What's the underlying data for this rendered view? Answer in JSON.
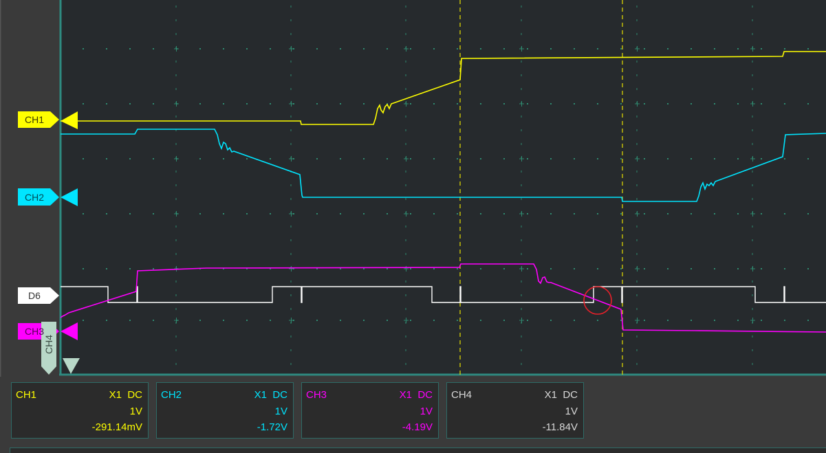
{
  "markers": {
    "ch1": {
      "label": "CH1",
      "color": "#ffff00"
    },
    "ch2": {
      "label": "CH2",
      "color": "#00e5ff"
    },
    "d6": {
      "label": "D6",
      "color": "#ffffff"
    },
    "ch3": {
      "label": "CH3",
      "color": "#ff00ff"
    },
    "ch4": {
      "label": "CH4",
      "color": "#b8d8c8"
    }
  },
  "channels": [
    {
      "name": "CH1",
      "probe": "X1",
      "coupling": "DC",
      "scale": "1V",
      "offset": "-291.14mV",
      "color": "#ffff00"
    },
    {
      "name": "CH2",
      "probe": "X1",
      "coupling": "DC",
      "scale": "1V",
      "offset": "-1.72V",
      "color": "#00e5ff"
    },
    {
      "name": "CH3",
      "probe": "X1",
      "coupling": "DC",
      "scale": "1V",
      "offset": "-4.19V",
      "color": "#ff00ff"
    },
    {
      "name": "CH4",
      "probe": "X1",
      "coupling": "DC",
      "scale": "1V",
      "offset": "-11.84V",
      "color": "#d8d8d8"
    }
  ],
  "colors": {
    "grid_bg": "#262a2d",
    "border": "#2e8a80",
    "cursor": "#e8e000",
    "grid_dots": "#2f8a70",
    "highlight": "#e8202a"
  }
}
